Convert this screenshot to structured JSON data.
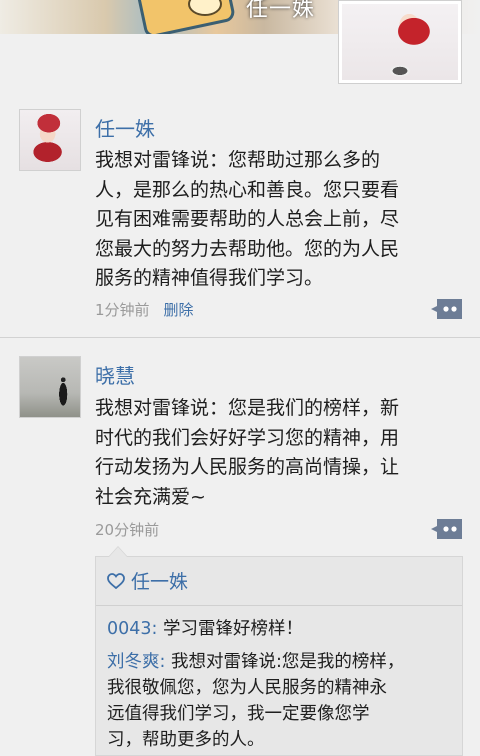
{
  "header": {
    "cover_name": "任一姝"
  },
  "posts": [
    {
      "author": "任一姝",
      "text": "我想对雷锋说：您帮助过那么多的\n人，是那么的热心和善良。您只要看\n见有困难需要帮助的人总会上前，尽\n您最大的努力去帮助他。您的为人民\n服务的精神值得我们学习。",
      "time": "1分钟前",
      "delete_label": "删除"
    },
    {
      "author": "晓慧",
      "text": "我想对雷锋说：您是我们的榜样，新\n时代的我们会好好学习您的精神，用\n行动发扬为人民服务的高尚情操，让\n社会充满爱~",
      "time": "20分钟前",
      "likes": "任一姝",
      "replies": [
        {
          "who": "0043:",
          "text": " 学习雷锋好榜样！"
        },
        {
          "who": "刘冬爽:",
          "text": " 我想对雷锋说:您是我的榜样，\n我很敬佩您，您为人民服务的精神永\n远值得我们学习，我一定要像您学\n习，帮助更多的人。"
        }
      ]
    }
  ],
  "colors": {
    "link_blue": "#3d6fa8",
    "comment_icon": "#6d7d96",
    "meta_gray": "#9a9a9a"
  },
  "icons": [
    "comment-bubble-icon",
    "heart-icon"
  ]
}
